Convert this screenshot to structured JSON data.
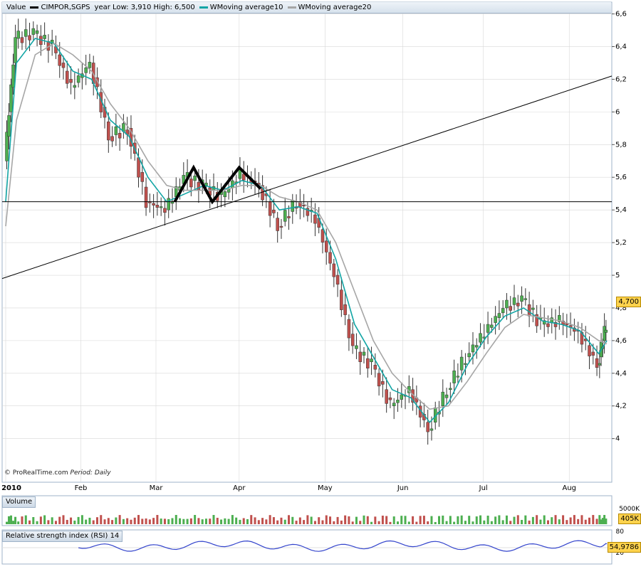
{
  "legend": {
    "label_value": "Value",
    "label_symbol": "CIMPOR,SGPS",
    "label_range": "year Low: 3,910 High: 6,500",
    "label_ma10": "WMoving average10",
    "label_ma20": "WMoving average20"
  },
  "footer": {
    "copyright": "© ProRealTime.com",
    "period_label": "Period:",
    "period_value": "Daily"
  },
  "volume_panel": {
    "title": "Volume",
    "tick_top": "5000K",
    "last_value": "405K"
  },
  "rsi_panel": {
    "title": "Relative strength index (RSI) 14",
    "tick_top": "80",
    "tick_bottom": "20",
    "last_value": "54,9786"
  },
  "price_tag": "4,700",
  "colors": {
    "up": "#4caf50",
    "down": "#c0504d",
    "ma10": "#12a5a5",
    "ma20": "#a6a6a6",
    "rsi": "#3344cc",
    "grid": "#d8d8d8",
    "tag": "#ffd34d"
  },
  "chart_data": {
    "type": "candlestick",
    "title": "CIMPOR,SGPS",
    "period": "Daily",
    "y_ticks": [
      "6,6",
      "6,4",
      "6,2",
      "6",
      "5,8",
      "5,6",
      "5,4",
      "5,2",
      "5",
      "4,8",
      "4,6",
      "4,4",
      "4,2",
      "4"
    ],
    "ylim": [
      3.82,
      6.62
    ],
    "x_ticks": [
      "2010",
      "Feb",
      "Mar",
      "Apr",
      "May",
      "Jun",
      "Jul",
      "Aug"
    ],
    "x_range": [
      "2010-01-04",
      "2010-08-16"
    ],
    "last_close": 4.7,
    "close_series": {
      "dates": [
        "2010-01-04",
        "2010-01-08",
        "2010-01-15",
        "2010-01-22",
        "2010-01-29",
        "2010-02-05",
        "2010-02-12",
        "2010-02-19",
        "2010-02-26",
        "2010-03-05",
        "2010-03-12",
        "2010-03-19",
        "2010-03-26",
        "2010-04-02",
        "2010-04-09",
        "2010-04-16",
        "2010-04-23",
        "2010-04-30",
        "2010-05-07",
        "2010-05-14",
        "2010-05-21",
        "2010-05-28",
        "2010-06-04",
        "2010-06-11",
        "2010-06-18",
        "2010-06-25",
        "2010-07-02",
        "2010-07-09",
        "2010-07-16",
        "2010-07-23",
        "2010-07-30",
        "2010-08-06",
        "2010-08-13",
        "2010-08-16"
      ],
      "values": [
        5.7,
        6.45,
        6.48,
        6.4,
        6.15,
        6.3,
        5.85,
        5.9,
        5.45,
        5.4,
        5.6,
        5.55,
        5.48,
        5.62,
        5.55,
        5.3,
        5.45,
        5.35,
        5.0,
        4.55,
        4.45,
        4.2,
        4.3,
        4.05,
        4.3,
        4.5,
        4.65,
        4.8,
        4.85,
        4.7,
        4.72,
        4.65,
        4.45,
        4.7
      ]
    },
    "series": [
      {
        "name": "WMoving average10",
        "values": [
          5.45,
          6.3,
          6.45,
          6.42,
          6.25,
          6.2,
          5.95,
          5.85,
          5.6,
          5.45,
          5.5,
          5.55,
          5.52,
          5.58,
          5.55,
          5.4,
          5.42,
          5.38,
          5.1,
          4.7,
          4.5,
          4.3,
          4.25,
          4.1,
          4.22,
          4.45,
          4.62,
          4.75,
          4.8,
          4.72,
          4.7,
          4.66,
          4.52,
          4.6
        ]
      },
      {
        "name": "WMoving average20",
        "values": [
          5.3,
          5.95,
          6.35,
          6.42,
          6.35,
          6.25,
          6.05,
          5.9,
          5.7,
          5.55,
          5.52,
          5.52,
          5.52,
          5.55,
          5.55,
          5.48,
          5.45,
          5.4,
          5.2,
          4.9,
          4.6,
          4.4,
          4.28,
          4.18,
          4.2,
          4.35,
          4.52,
          4.68,
          4.76,
          4.74,
          4.72,
          4.68,
          4.6,
          4.58
        ]
      }
    ],
    "annotations": [
      {
        "type": "horizontal_line",
        "value": 5.45
      },
      {
        "type": "trend_line",
        "from": {
          "date": "2010-01-04",
          "value": 4.98
        },
        "to": {
          "date": "2010-08-16",
          "value": 6.22
        }
      },
      {
        "type": "pattern",
        "name": "M",
        "points": [
          {
            "date": "2010-03-08",
            "value": 5.45
          },
          {
            "date": "2010-03-15",
            "value": 5.66
          },
          {
            "date": "2010-03-22",
            "value": 5.45
          },
          {
            "date": "2010-04-01",
            "value": 5.66
          },
          {
            "date": "2010-04-09",
            "value": 5.53
          }
        ]
      }
    ],
    "volume": {
      "unit": "K",
      "last": 405
    },
    "rsi": {
      "period": 14,
      "last": 54.9786,
      "levels": [
        80,
        20
      ]
    }
  }
}
